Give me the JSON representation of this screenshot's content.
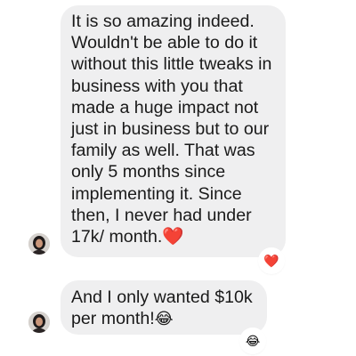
{
  "messages": [
    {
      "text": "It is so amazing indeed. Wouldn't be able to do it without this little tweaks in business with you that made a huge impact not just in business but to our family as well. That was only 5 months since implementing it. Since then, I never had under 17k/ month.",
      "inline_emoji": "❤️",
      "reaction": "❤️"
    },
    {
      "text": "And I only wanted $10k per month!",
      "inline_emoji": "😂",
      "reaction": "😂"
    }
  ],
  "colors": {
    "bubble_bg": "#efeff0",
    "text": "#1a1a1a",
    "heart": "#e0202a",
    "avatar_hair": "#1e1a1a",
    "avatar_skin": "#c9967a"
  },
  "icons": {
    "avatar": "person-avatar-icon",
    "reaction_heart": "heart-icon",
    "reaction_laugh": "laughing-emoji-icon"
  }
}
